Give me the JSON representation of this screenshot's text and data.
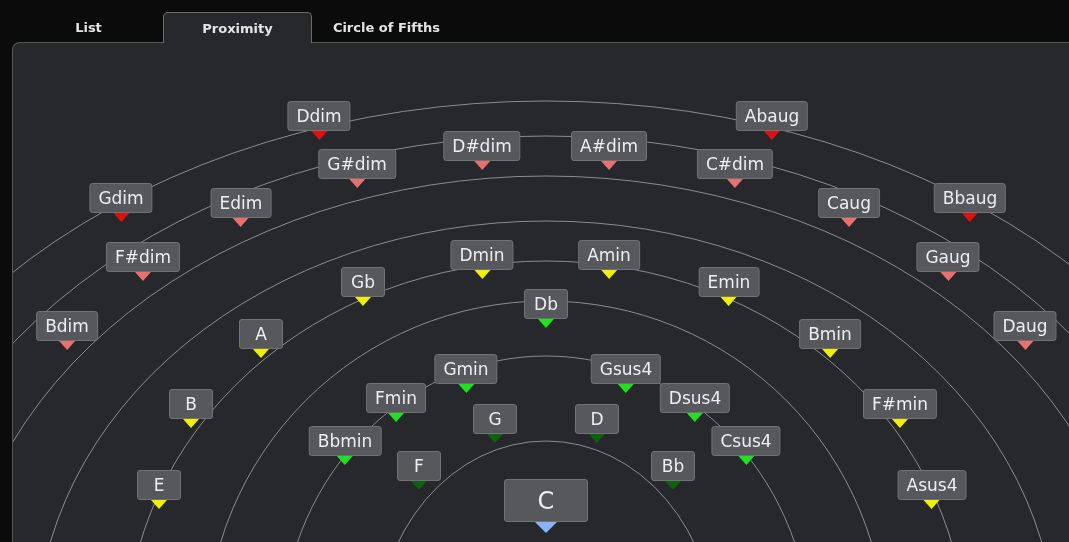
{
  "tabs": [
    {
      "label": "List",
      "selected": false
    },
    {
      "label": "Proximity",
      "selected": true
    },
    {
      "label": "Circle of Fifths",
      "selected": false
    }
  ],
  "chords": [
    {
      "label": "Ddim",
      "color": "#e01010"
    },
    {
      "label": "Abaug",
      "color": "#e01010"
    },
    {
      "label": "D#dim",
      "color": "#e87070"
    },
    {
      "label": "A#dim",
      "color": "#e87070"
    },
    {
      "label": "G#dim",
      "color": "#e87070"
    },
    {
      "label": "C#dim",
      "color": "#e87070"
    },
    {
      "label": "Gdim",
      "color": "#e01010"
    },
    {
      "label": "Edim",
      "color": "#e87070"
    },
    {
      "label": "Caug",
      "color": "#e87070"
    },
    {
      "label": "Bbaug",
      "color": "#e01010"
    },
    {
      "label": "F#dim",
      "color": "#e87070"
    },
    {
      "label": "Gaug",
      "color": "#e87070"
    },
    {
      "label": "Bdim",
      "color": "#e87070"
    },
    {
      "label": "Daug",
      "color": "#e87070"
    },
    {
      "label": "Dmin",
      "color": "#f0f000"
    },
    {
      "label": "Amin",
      "color": "#f0f000"
    },
    {
      "label": "Gb",
      "color": "#f0f000"
    },
    {
      "label": "Emin",
      "color": "#f0f000"
    },
    {
      "label": "Db",
      "color": "#20e020"
    },
    {
      "label": "A",
      "color": "#f0f000"
    },
    {
      "label": "Bmin",
      "color": "#f0f000"
    },
    {
      "label": "Gmin",
      "color": "#20e020"
    },
    {
      "label": "Gsus4",
      "color": "#20e020"
    },
    {
      "label": "Fmin",
      "color": "#20e020"
    },
    {
      "label": "Dsus4",
      "color": "#20e020"
    },
    {
      "label": "B",
      "color": "#f0f000"
    },
    {
      "label": "F#min",
      "color": "#f0f000"
    },
    {
      "label": "G",
      "color": "#106010"
    },
    {
      "label": "D",
      "color": "#106010"
    },
    {
      "label": "Bbmin",
      "color": "#20e020"
    },
    {
      "label": "Csus4",
      "color": "#20e020"
    },
    {
      "label": "F",
      "color": "#106010"
    },
    {
      "label": "Bb",
      "color": "#106010"
    },
    {
      "label": "E",
      "color": "#f0f000"
    },
    {
      "label": "Asus4",
      "color": "#f0f000"
    },
    {
      "label": "C",
      "color": "#8ab4f8",
      "kind": "root"
    }
  ]
}
